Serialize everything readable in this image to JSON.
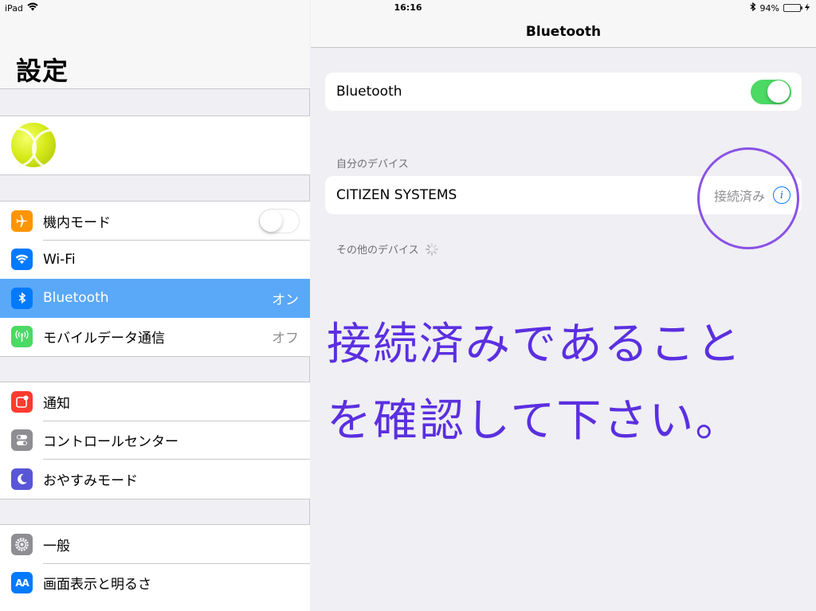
{
  "status_bar": {
    "device": "iPad",
    "time": "16:16",
    "battery_percent": "94%",
    "battery_level": 0.94
  },
  "master": {
    "title": "設定",
    "group1": [
      {
        "name": "airplane-mode",
        "label": "機内モード",
        "icon": "airplane-icon",
        "color": "#ff9500",
        "toggle": "off"
      },
      {
        "name": "wifi",
        "label": "Wi-Fi",
        "icon": "wifi-icon",
        "color": "#007aff",
        "value": ""
      },
      {
        "name": "bluetooth",
        "label": "Bluetooth",
        "icon": "bluetooth-icon",
        "color": "#007aff",
        "value": "オン",
        "selected": true
      },
      {
        "name": "mobile-data",
        "label": "モバイルデータ通信",
        "icon": "antenna-icon",
        "color": "#4cd964",
        "value": "オフ"
      }
    ],
    "group2": [
      {
        "name": "notifications",
        "label": "通知",
        "icon": "notification-icon",
        "color": "#ff3b30"
      },
      {
        "name": "control-center",
        "label": "コントロールセンター",
        "icon": "switches-icon",
        "color": "#8e8e93"
      },
      {
        "name": "do-not-disturb",
        "label": "おやすみモード",
        "icon": "moon-icon",
        "color": "#5856d6"
      }
    ],
    "group3": [
      {
        "name": "general",
        "label": "一般",
        "icon": "gear-icon",
        "color": "#8e8e93"
      },
      {
        "name": "display-brightness",
        "label": "画面表示と明るさ",
        "icon": "text-size-icon",
        "color": "#007aff"
      }
    ]
  },
  "detail": {
    "title": "Bluetooth",
    "bluetooth_label": "Bluetooth",
    "bluetooth_on": true,
    "my_devices_header": "自分のデバイス",
    "device_name": "CITIZEN SYSTEMS",
    "device_status": "接続済み",
    "other_devices_header": "その他のデバイス"
  },
  "annotation": {
    "line1": "接続済みであること",
    "line2": "を確認して下さい。",
    "color": "#5b2fe0",
    "circle_color": "#8a52e6"
  }
}
